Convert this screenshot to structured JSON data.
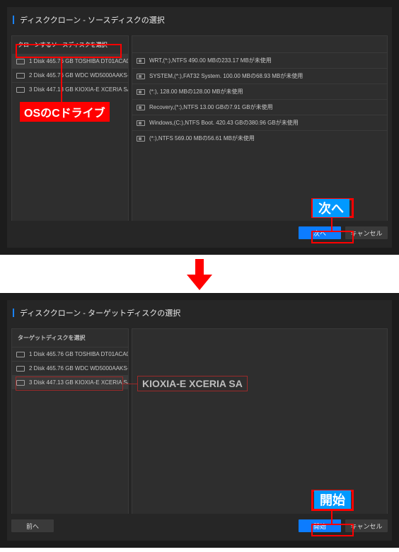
{
  "panel1": {
    "title": "ディスククローン - ソースディスクの選択",
    "left_header": "クローンするソースディスクを選択",
    "disks": [
      "1 Disk 465.76 GB TOSHIBA DT01ACA0",
      "2 Disk 465.76 GB WDC WD5000AAKS-",
      "3 Disk 447.13 GB KIOXIA-E XCERIA SA"
    ],
    "partitions": [
      "WRT,(*:),NTFS    490.00 MBの233.17 MBが未使用",
      "SYSTEM,(*:),FAT32 System.    100.00 MBの68.93 MBが未使用",
      "(*:),    128.00 MBの128.00 MBが未使用",
      "Recovery,(*:),NTFS    13.00 GBの7.91 GBが未使用",
      "Windows,(C:),NTFS Boot.    420.43 GBの380.96 GBが未使用",
      "(*:),NTFS    569.00 MBの56.61 MBが未使用"
    ],
    "buttons": {
      "next": "次へ",
      "cancel": "キャンセル"
    },
    "annotations": {
      "source_disk_label": "OSのCドライブ",
      "next_callout": "次へ"
    }
  },
  "panel2": {
    "title": "ディスククローン - ターゲットディスクの選択",
    "left_header": "ターゲットディスクを選択",
    "disks": [
      "1 Disk 465.76 GB TOSHIBA DT01ACA0",
      "2 Disk 465.76 GB WDC WD5000AAKS-",
      "3 Disk 447.13 GB KIOXIA-E XCERIA SA"
    ],
    "buttons": {
      "back": "前へ",
      "start": "開始",
      "cancel": "キャンセル"
    },
    "annotations": {
      "target_disk_label": "KIOXIA-E XCERIA SA",
      "start_callout": "開始"
    }
  }
}
